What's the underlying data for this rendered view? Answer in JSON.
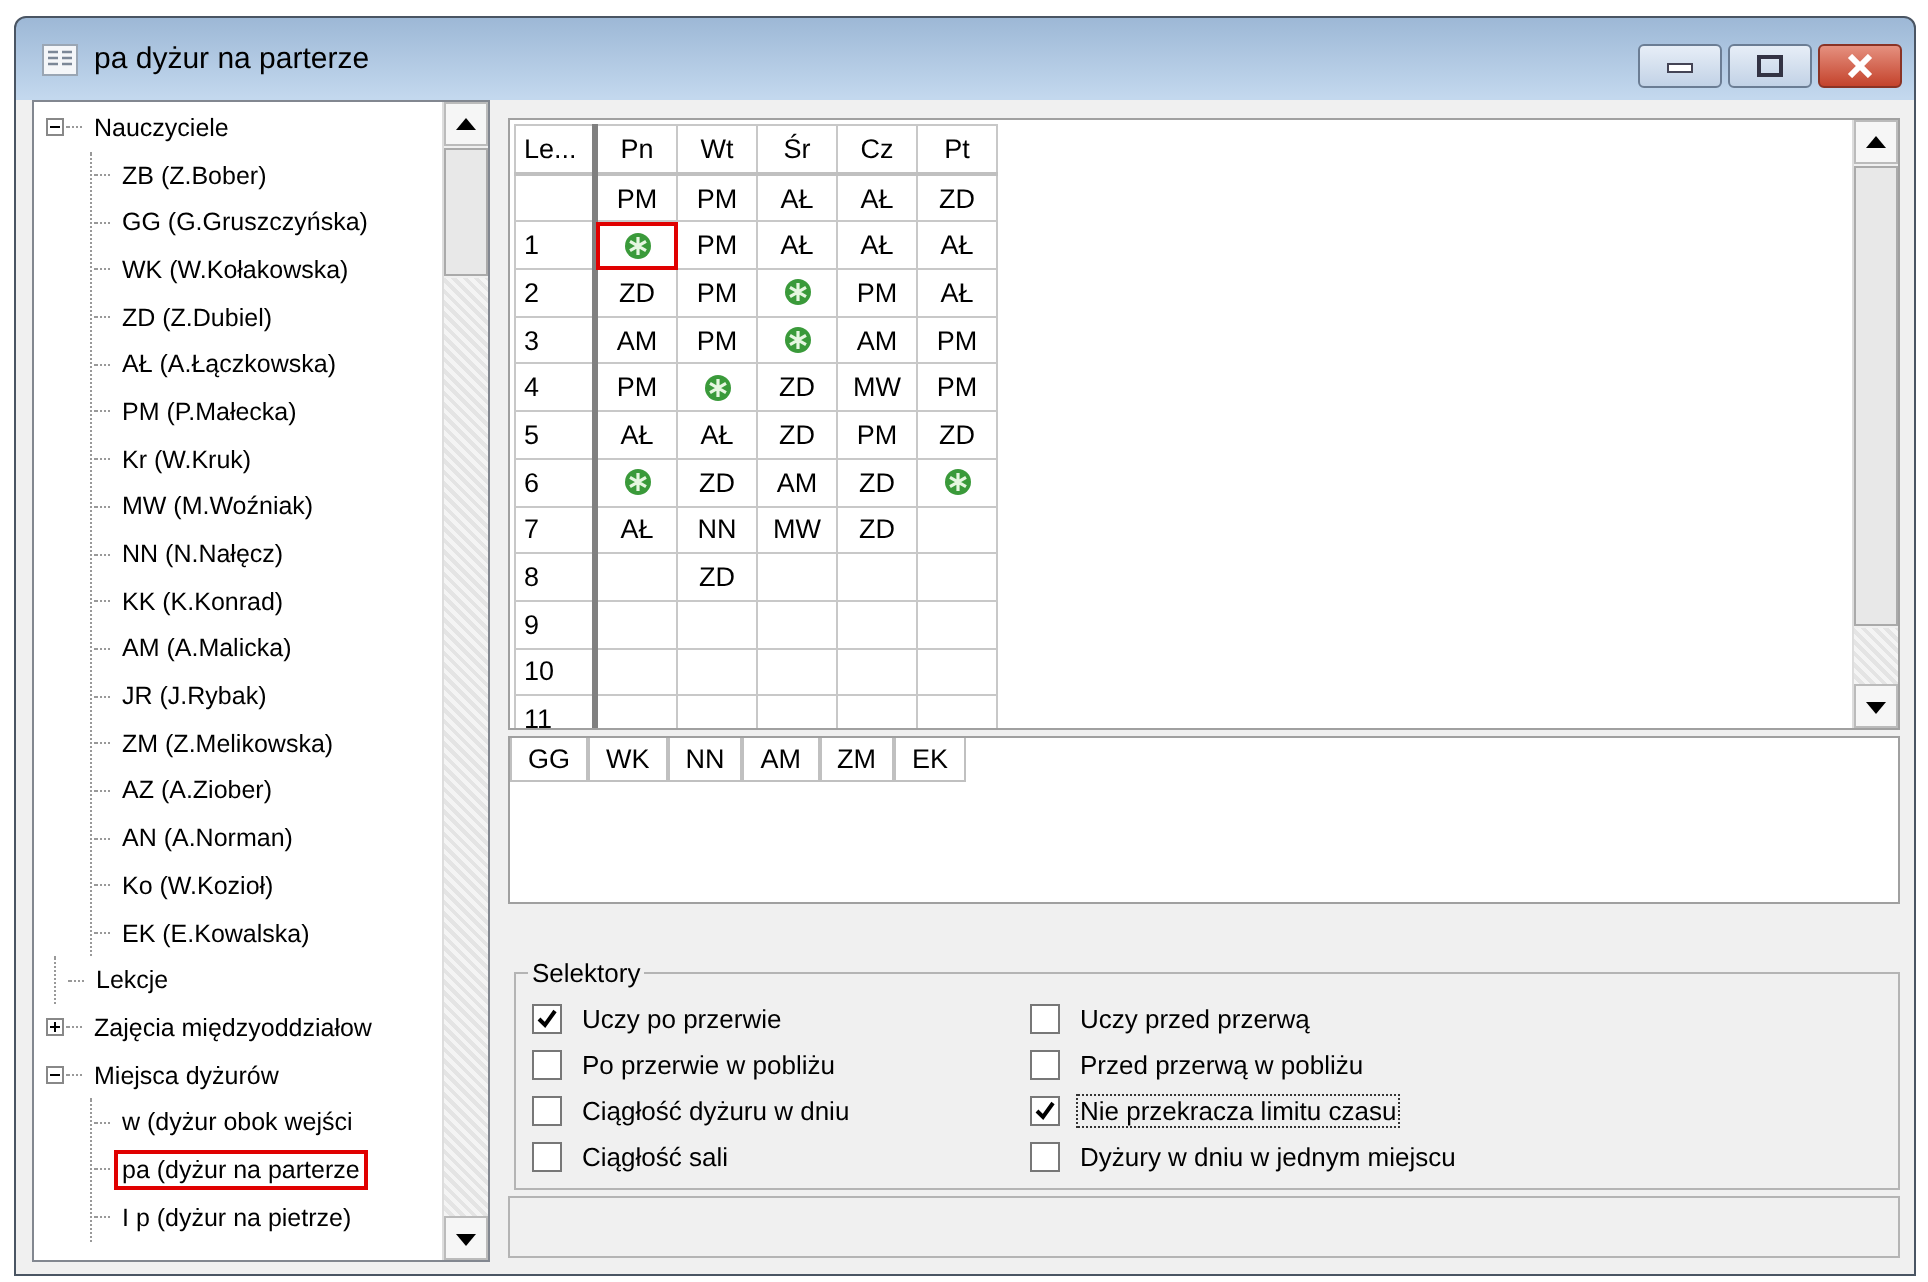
{
  "window": {
    "title": "pa dyżur na parterze"
  },
  "tree": [
    {
      "label": "Nauczyciele",
      "expanded": true,
      "selected": false,
      "children": [
        {
          "label": "ZB (Z.Bober)",
          "selected": false
        },
        {
          "label": "GG (G.Gruszczyńska)",
          "selected": false
        },
        {
          "label": "WK (W.Kołakowska)",
          "selected": false
        },
        {
          "label": "ZD (Z.Dubiel)",
          "selected": false
        },
        {
          "label": "AŁ (A.Łączkowska)",
          "selected": false
        },
        {
          "label": "PM (P.Małecka)",
          "selected": false
        },
        {
          "label": "Kr (W.Kruk)",
          "selected": false
        },
        {
          "label": "MW (M.Woźniak)",
          "selected": false
        },
        {
          "label": "NN (N.Nałęcz)",
          "selected": false
        },
        {
          "label": "KK (K.Konrad)",
          "selected": false
        },
        {
          "label": "AM (A.Malicka)",
          "selected": false
        },
        {
          "label": "JR (J.Rybak)",
          "selected": false
        },
        {
          "label": "ZM (Z.Melikowska)",
          "selected": false
        },
        {
          "label": "AZ (A.Ziober)",
          "selected": false
        },
        {
          "label": "AN (A.Norman)",
          "selected": false
        },
        {
          "label": "Ko (W.Kozioł)",
          "selected": false
        },
        {
          "label": "EK (E.Kowalska)",
          "selected": false
        }
      ]
    },
    {
      "label": "Lekcje",
      "selected": false
    },
    {
      "label": "Zajęcia międzyoddziałow",
      "expanded": false,
      "selected": false
    },
    {
      "label": "Miejsca dyżurów",
      "expanded": true,
      "selected": false,
      "children": [
        {
          "label": "w (dyżur obok wejści",
          "selected": false
        },
        {
          "label": "pa (dyżur na parterze",
          "selected": true
        },
        {
          "label": "I p (dyżur na pietrze)",
          "selected": false
        }
      ]
    }
  ],
  "grid": {
    "columns": [
      "Le...",
      "Pn",
      "Wt",
      "Śr",
      "Cz",
      "Pt"
    ],
    "rows": [
      {
        "cells": [
          {
            "kind": "label",
            "text": "",
            "selected": false
          },
          {
            "kind": "text",
            "text": "PM",
            "selected": false
          },
          {
            "kind": "text",
            "text": "PM",
            "selected": false
          },
          {
            "kind": "text",
            "text": "AŁ",
            "selected": false
          },
          {
            "kind": "text",
            "text": "AŁ",
            "selected": false
          },
          {
            "kind": "text",
            "text": "ZD",
            "selected": false
          }
        ]
      },
      {
        "cells": [
          {
            "kind": "label",
            "text": "1",
            "selected": false
          },
          {
            "kind": "star",
            "selected": true
          },
          {
            "kind": "text",
            "text": "PM",
            "selected": false
          },
          {
            "kind": "text",
            "text": "AŁ",
            "selected": false
          },
          {
            "kind": "text",
            "text": "AŁ",
            "selected": false
          },
          {
            "kind": "text",
            "text": "AŁ",
            "selected": false
          }
        ]
      },
      {
        "cells": [
          {
            "kind": "label",
            "text": "2",
            "selected": false
          },
          {
            "kind": "text",
            "text": "ZD",
            "selected": false
          },
          {
            "kind": "text",
            "text": "PM",
            "selected": false
          },
          {
            "kind": "star",
            "selected": false
          },
          {
            "kind": "text",
            "text": "PM",
            "selected": false
          },
          {
            "kind": "text",
            "text": "AŁ",
            "selected": false
          }
        ]
      },
      {
        "cells": [
          {
            "kind": "label",
            "text": "3",
            "selected": false
          },
          {
            "kind": "text",
            "text": "AM",
            "selected": false
          },
          {
            "kind": "text",
            "text": "PM",
            "selected": false
          },
          {
            "kind": "star",
            "selected": false
          },
          {
            "kind": "text",
            "text": "AM",
            "selected": false
          },
          {
            "kind": "text",
            "text": "PM",
            "selected": false
          }
        ]
      },
      {
        "cells": [
          {
            "kind": "label",
            "text": "4",
            "selected": false
          },
          {
            "kind": "text",
            "text": "PM",
            "selected": false
          },
          {
            "kind": "star",
            "selected": false
          },
          {
            "kind": "text",
            "text": "ZD",
            "selected": false
          },
          {
            "kind": "text",
            "text": "MW",
            "selected": false
          },
          {
            "kind": "text",
            "text": "PM",
            "selected": false
          }
        ]
      },
      {
        "cells": [
          {
            "kind": "label",
            "text": "5",
            "selected": false
          },
          {
            "kind": "text",
            "text": "AŁ",
            "selected": false
          },
          {
            "kind": "text",
            "text": "AŁ",
            "selected": false
          },
          {
            "kind": "text",
            "text": "ZD",
            "selected": false
          },
          {
            "kind": "text",
            "text": "PM",
            "selected": false
          },
          {
            "kind": "text",
            "text": "ZD",
            "selected": false
          }
        ]
      },
      {
        "cells": [
          {
            "kind": "label",
            "text": "6",
            "selected": false
          },
          {
            "kind": "star",
            "selected": false
          },
          {
            "kind": "text",
            "text": "ZD",
            "selected": false
          },
          {
            "kind": "text",
            "text": "AM",
            "selected": false
          },
          {
            "kind": "text",
            "text": "ZD",
            "selected": false
          },
          {
            "kind": "star",
            "selected": false
          }
        ]
      },
      {
        "cells": [
          {
            "kind": "label",
            "text": "7",
            "selected": false
          },
          {
            "kind": "text",
            "text": "AŁ",
            "selected": false
          },
          {
            "kind": "text",
            "text": "NN",
            "selected": false
          },
          {
            "kind": "text",
            "text": "MW",
            "selected": false
          },
          {
            "kind": "text",
            "text": "ZD",
            "selected": false
          },
          {
            "kind": "empty",
            "selected": false
          }
        ]
      },
      {
        "cells": [
          {
            "kind": "label",
            "text": "8",
            "selected": false
          },
          {
            "kind": "empty",
            "selected": false
          },
          {
            "kind": "text",
            "text": "ZD",
            "selected": false
          },
          {
            "kind": "empty",
            "selected": false
          },
          {
            "kind": "empty",
            "selected": false
          },
          {
            "kind": "empty",
            "selected": false
          }
        ]
      },
      {
        "cells": [
          {
            "kind": "label",
            "text": "9",
            "selected": false
          },
          {
            "kind": "empty",
            "selected": false
          },
          {
            "kind": "empty",
            "selected": false
          },
          {
            "kind": "empty",
            "selected": false
          },
          {
            "kind": "empty",
            "selected": false
          },
          {
            "kind": "empty",
            "selected": false
          }
        ]
      },
      {
        "cells": [
          {
            "kind": "label",
            "text": "10",
            "selected": false
          },
          {
            "kind": "empty",
            "selected": false
          },
          {
            "kind": "empty",
            "selected": false
          },
          {
            "kind": "empty",
            "selected": false
          },
          {
            "kind": "empty",
            "selected": false
          },
          {
            "kind": "empty",
            "selected": false
          }
        ]
      },
      {
        "cells": [
          {
            "kind": "label",
            "text": "11",
            "selected": false
          },
          {
            "kind": "empty",
            "selected": false
          },
          {
            "kind": "empty",
            "selected": false
          },
          {
            "kind": "empty",
            "selected": false
          },
          {
            "kind": "empty",
            "selected": false
          },
          {
            "kind": "empty",
            "selected": false
          }
        ]
      }
    ]
  },
  "teachers_list": [
    "GG",
    "WK",
    "NN",
    "AM",
    "ZM",
    "EK"
  ],
  "selectors": {
    "title": "Selektory",
    "items": [
      {
        "label": "Uczy po przerwie",
        "checked": true,
        "focused": false
      },
      {
        "label": "Po przerwie w pobliżu",
        "checked": false,
        "focused": false
      },
      {
        "label": "Ciągłość dyżuru w dniu",
        "checked": false,
        "focused": false
      },
      {
        "label": "Ciągłość sali",
        "checked": false,
        "focused": false
      },
      {
        "label": "Uczy przed przerwą",
        "checked": false,
        "focused": false
      },
      {
        "label": "Przed przerwą w pobliżu",
        "checked": false,
        "focused": false
      },
      {
        "label": "Nie przekracza limitu czasu",
        "checked": true,
        "focused": true
      },
      {
        "label": "Dyżury w dniu w jednym miejscu",
        "checked": false,
        "focused": false
      }
    ]
  }
}
